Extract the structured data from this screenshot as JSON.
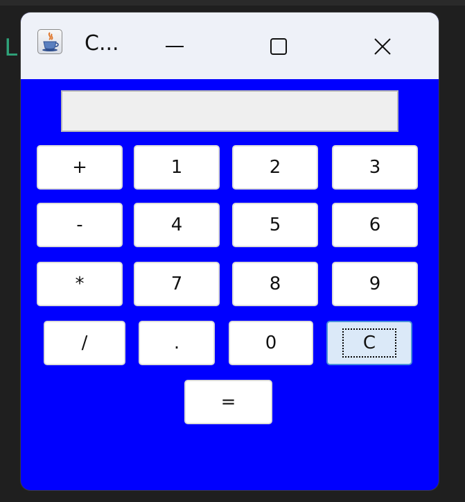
{
  "window": {
    "title": "C...",
    "app_icon": "java-cup-icon",
    "controls": {
      "minimize": "minimize-icon",
      "maximize": "maximize-icon",
      "close": "close-icon"
    }
  },
  "display": {
    "value": ""
  },
  "keys": {
    "plus": "+",
    "one": "1",
    "two": "2",
    "three": "3",
    "minus": "-",
    "four": "4",
    "five": "5",
    "six": "6",
    "multiply": "*",
    "seven": "7",
    "eight": "8",
    "nine": "9",
    "divide": "/",
    "dot": ".",
    "zero": "0",
    "clear": "C",
    "equals": "="
  },
  "colors": {
    "panel": "#0000ff",
    "titlebar": "#eef1f8",
    "focused_key": "#dbe9f8"
  }
}
